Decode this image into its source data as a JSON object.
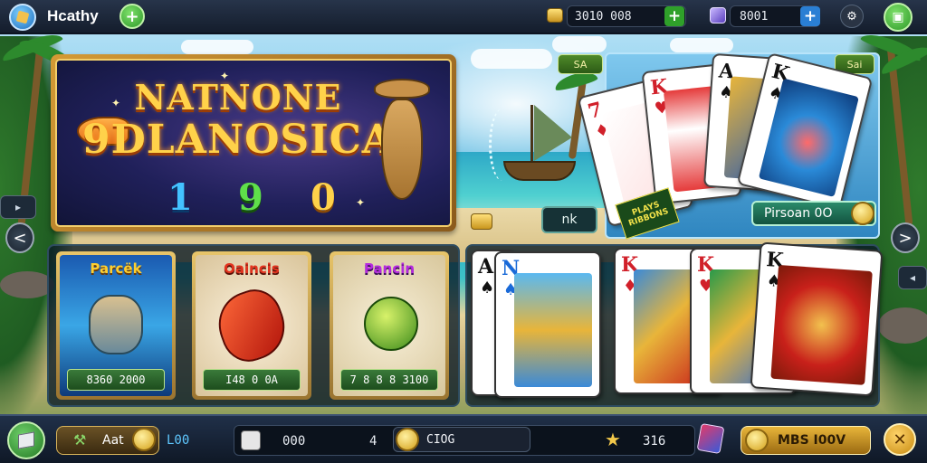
{
  "header": {
    "username": "Hcathy",
    "gold_value": "3010 008",
    "gem_value": "8001"
  },
  "banner": {
    "title_line1": "NATNONE",
    "title_line2": "9DLANOSICA",
    "digits": [
      "1",
      "9",
      "0"
    ]
  },
  "badges": {
    "left_badge": "SA",
    "right_badge": "Sai",
    "nk_button": "nk",
    "card_promo_label": "PLAYS RIBBONS",
    "prize_label": "Pirsoan 0O"
  },
  "tiles": [
    {
      "title": "Parcëk",
      "price": "8360 2000",
      "title_color": "#ffcf2e"
    },
    {
      "title": "Oaincis",
      "price": "I48 0 0A",
      "title_color": "#e2331e"
    },
    {
      "title": "Pancin",
      "price": "7 8 8 8 3100",
      "title_color": "#b52adf"
    }
  ],
  "featured_cards": [
    {
      "rank": "7",
      "suit": "♦",
      "color": "red"
    },
    {
      "rank": "K",
      "suit": "♥",
      "color": "red"
    },
    {
      "rank": "A",
      "suit": "♠",
      "color": "black"
    },
    {
      "rank": "K",
      "suit": "♠",
      "color": "black"
    }
  ],
  "hand_cards": [
    {
      "rank": "A",
      "suit": "♠",
      "color": "black"
    },
    {
      "rank": "N",
      "suit": "♠",
      "color": "blue"
    },
    {
      "rank": "K",
      "suit": "♦",
      "color": "red"
    },
    {
      "rank": "K",
      "suit": "♥",
      "color": "red"
    },
    {
      "rank": "K",
      "suit": "♠",
      "color": "black"
    }
  ],
  "footer": {
    "left_label": "Aat",
    "left_value": "L00",
    "field_left": "000",
    "field_count": "4",
    "field_center": "CIOG",
    "star_value": "316",
    "right_button": "MBS I00V"
  },
  "nav": {
    "left_arrow": "<",
    "right_arrow": ">",
    "close": "✕"
  }
}
